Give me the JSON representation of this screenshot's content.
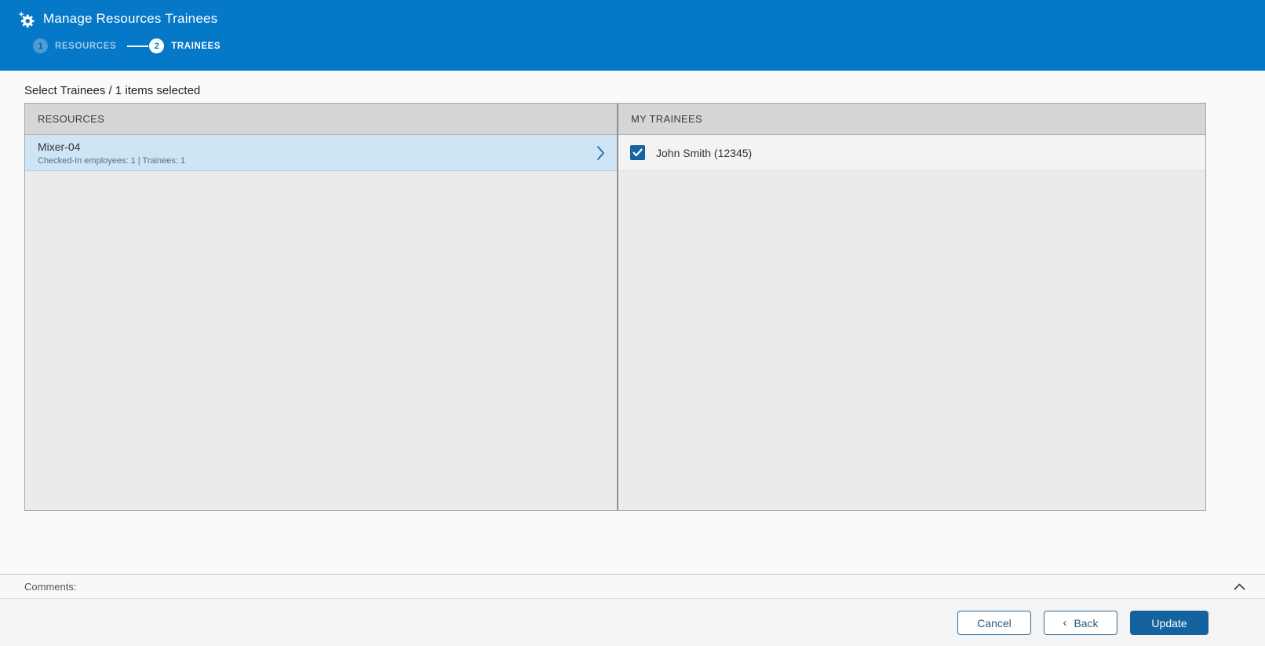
{
  "header": {
    "title": "Manage Resources Trainees",
    "icon": "manage-gear-icon",
    "steps": [
      {
        "number": "1",
        "label": "RESOURCES",
        "state": "done"
      },
      {
        "number": "2",
        "label": "TRAINEES",
        "state": "active"
      }
    ]
  },
  "summary": "Select Trainees / 1 items selected",
  "panels": {
    "resources": {
      "header": "RESOURCES",
      "items": [
        {
          "title": "Mixer-04",
          "subtitle": "Checked-In employees: 1 | Trainees: 1",
          "selected": true
        }
      ]
    },
    "my_trainees": {
      "header": "MY TRAINEES",
      "items": [
        {
          "label": "John Smith (12345)",
          "checked": true
        }
      ]
    }
  },
  "comments": {
    "label": "Comments:",
    "collapse_icon": "chevron-up-icon",
    "expanded": true
  },
  "footer": {
    "cancel_label": "Cancel",
    "back_chevron": "‹",
    "back_label": "Back",
    "update_label": "Update"
  },
  "colors": {
    "header_bg": "#0578c8",
    "primary_button_bg": "#15639e",
    "selected_row_bg": "#cde5f5",
    "checkbox_bg": "#1565a5",
    "panel_header_bg": "#d6d6d6"
  }
}
